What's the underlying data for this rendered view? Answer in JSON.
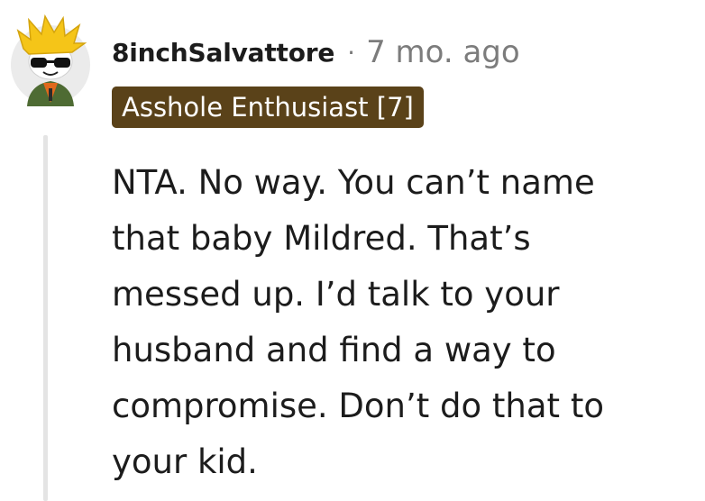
{
  "comment": {
    "author": "8inchSalvattore",
    "separator": "·",
    "timestamp": "7 mo. ago",
    "flair": "Asshole Enthusiast [7]",
    "body_lines": [
      "NTA. No way. You can’t name",
      "that baby Mildred. That’s",
      "messed up. I’d talk to your",
      "husband and find a way to",
      "compromise. Don’t do that to",
      "your kid."
    ]
  },
  "avatar": {
    "icon": "snoo-avatar-icon",
    "hair_color": "#f5c518",
    "jacket_color": "#5b7a3a",
    "bg_color": "#e8e8e8"
  },
  "colors": {
    "flair_bg": "#5a4219",
    "text": "#1c1c1c",
    "muted": "#7c7c7c",
    "thread_line": "#e4e4e4"
  }
}
